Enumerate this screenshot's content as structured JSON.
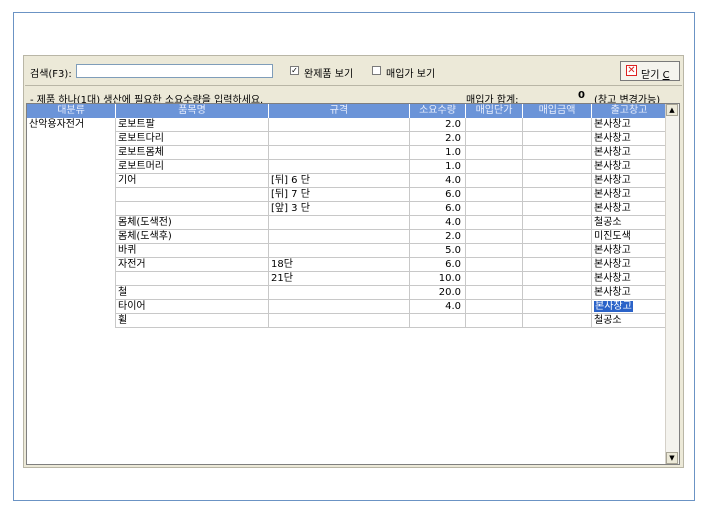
{
  "toolbar": {
    "search_label": "검색(F3):",
    "search_value": "",
    "show_finished_label": "완제품 보기",
    "show_finished_checked": true,
    "show_purchase_price_label": "매입가 보기",
    "show_purchase_price_checked": false,
    "close_label": "닫기",
    "close_hotkey": "C"
  },
  "info": {
    "instruction": "- 제품 하나(1대) 생산에 필요한 소요수량을 입력하세요.",
    "purchase_total_label": "매입가 합계:",
    "purchase_total_value": "0",
    "note": "(창고 변경가능)"
  },
  "table": {
    "columns": [
      "대분류",
      "품목명",
      "규격",
      "소요수량",
      "매입단가",
      "매입금액",
      "출고창고"
    ],
    "rows": [
      {
        "category": "산악용자전거",
        "item": "로보트팔",
        "spec": "",
        "qty": "2.0",
        "unit_price": "",
        "amount": "",
        "warehouse": "본사창고"
      },
      {
        "category": "",
        "item": "로보트다리",
        "spec": "",
        "qty": "2.0",
        "unit_price": "",
        "amount": "",
        "warehouse": "본사창고"
      },
      {
        "category": "",
        "item": "로보트몸체",
        "spec": "",
        "qty": "1.0",
        "unit_price": "",
        "amount": "",
        "warehouse": "본사창고"
      },
      {
        "category": "",
        "item": "로보트머리",
        "spec": "",
        "qty": "1.0",
        "unit_price": "",
        "amount": "",
        "warehouse": "본사창고"
      },
      {
        "category": "",
        "item": "기어",
        "spec": "[뒤] 6 단",
        "qty": "4.0",
        "unit_price": "",
        "amount": "",
        "warehouse": "본사창고"
      },
      {
        "category": "",
        "item": "",
        "spec": "[뒤] 7 단",
        "qty": "6.0",
        "unit_price": "",
        "amount": "",
        "warehouse": "본사창고"
      },
      {
        "category": "",
        "item": "",
        "spec": "[앞] 3 단",
        "qty": "6.0",
        "unit_price": "",
        "amount": "",
        "warehouse": "본사창고"
      },
      {
        "category": "",
        "item": "몸체(도색전)",
        "spec": "",
        "qty": "4.0",
        "unit_price": "",
        "amount": "",
        "warehouse": "철공소"
      },
      {
        "category": "",
        "item": "몸체(도색후)",
        "spec": "",
        "qty": "2.0",
        "unit_price": "",
        "amount": "",
        "warehouse": "미진도색"
      },
      {
        "category": "",
        "item": "바퀴",
        "spec": "",
        "qty": "5.0",
        "unit_price": "",
        "amount": "",
        "warehouse": "본사창고"
      },
      {
        "category": "",
        "item": "자전거",
        "spec": "18단",
        "qty": "6.0",
        "unit_price": "",
        "amount": "",
        "warehouse": "본사창고"
      },
      {
        "category": "",
        "item": "",
        "spec": "21단",
        "qty": "10.0",
        "unit_price": "",
        "amount": "",
        "warehouse": "본사창고"
      },
      {
        "category": "",
        "item": "철",
        "spec": "",
        "qty": "20.0",
        "unit_price": "",
        "amount": "",
        "warehouse": "본사창고"
      },
      {
        "category": "",
        "item": "타이어",
        "spec": "",
        "qty": "4.0",
        "unit_price": "",
        "amount": "",
        "warehouse": "본사창고",
        "selected": true
      },
      {
        "category": "",
        "item": "휠",
        "spec": "",
        "qty": "",
        "unit_price": "",
        "amount": "",
        "warehouse": "철공소"
      }
    ]
  },
  "colors": {
    "header_bg": "#6b94d8",
    "selection": "#2a62c8",
    "panel_bg": "#ece9d8",
    "frame_border": "#6b93c4"
  },
  "icons": {
    "close": "close-x-icon",
    "scroll_up": "scroll-up-arrow-icon",
    "scroll_down": "scroll-down-arrow-icon"
  }
}
